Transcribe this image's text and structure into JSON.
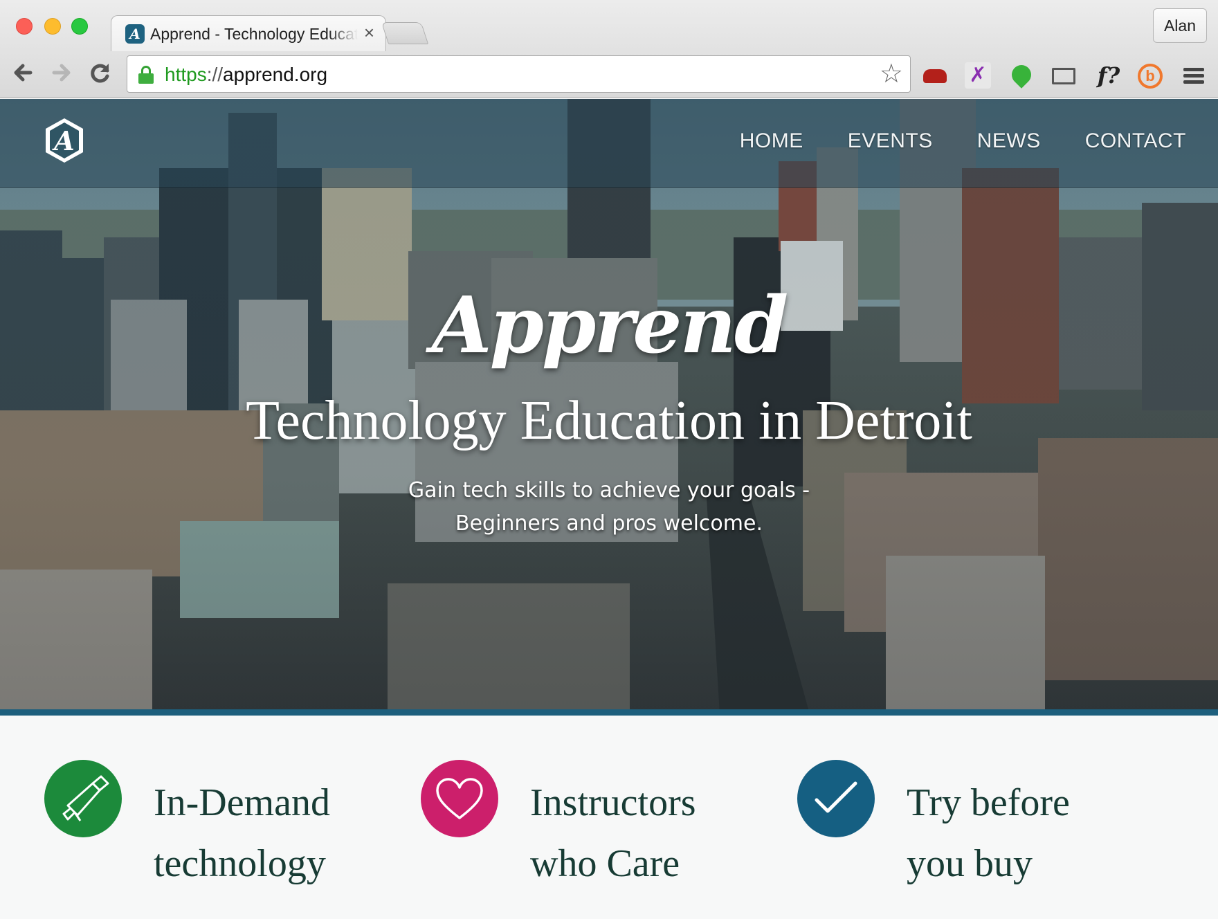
{
  "browser": {
    "tab_title": "Apprend - Technology Education",
    "tab_close": "×",
    "profile_name": "Alan",
    "url_scheme": "https",
    "url_sep": "://",
    "url_host": "apprend.org",
    "extensions": [
      "couch-icon",
      "bird-icon",
      "evernote-leaf-icon",
      "cast-icon",
      "font-finder-icon",
      "bitly-icon",
      "menu-icon"
    ]
  },
  "site": {
    "nav": [
      "HOME",
      "EVENTS",
      "NEWS",
      "CONTACT"
    ],
    "hero": {
      "brand": "Apprend",
      "title": "Technology Education in Detroit",
      "subtitle_line1": "Gain tech skills to achieve your goals -",
      "subtitle_line2": "Beginners and pros welcome."
    },
    "features": [
      {
        "line1": "In-Demand",
        "line2": "technology",
        "icon": "megaphone-icon",
        "color": "#1c8a3b"
      },
      {
        "line1": "Instructors",
        "line2": "who Care",
        "icon": "heart-icon",
        "color": "#cc1f6b"
      },
      {
        "line1": "Try before",
        "line2": "you buy",
        "icon": "checkmark-icon",
        "color": "#155f82"
      }
    ]
  },
  "colors": {
    "accent_bar": "#1d5f7d",
    "feature_text": "#173b34"
  }
}
